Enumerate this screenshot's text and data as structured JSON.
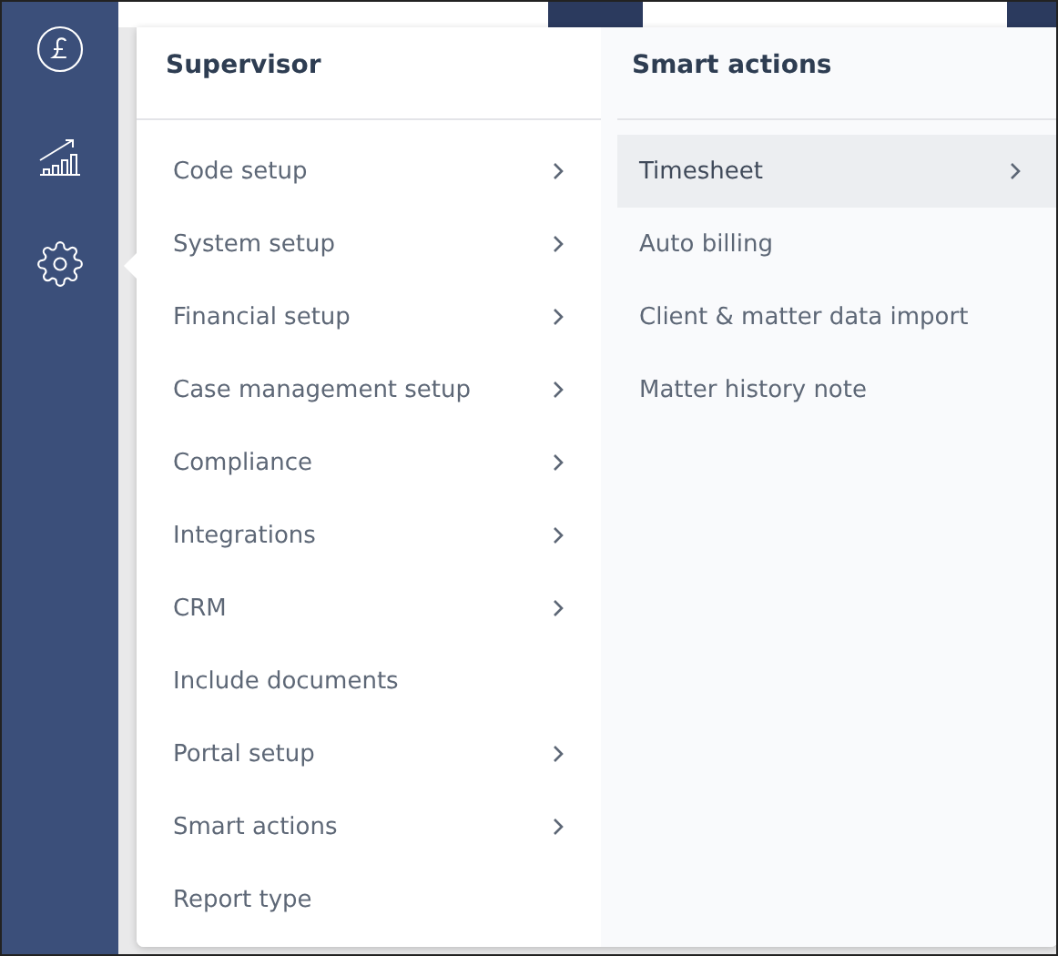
{
  "menu": {
    "title": "Supervisor",
    "items": [
      {
        "label": "Code setup",
        "has_submenu": true
      },
      {
        "label": "System setup",
        "has_submenu": true
      },
      {
        "label": "Financial setup",
        "has_submenu": true
      },
      {
        "label": "Case management setup",
        "has_submenu": true
      },
      {
        "label": "Compliance",
        "has_submenu": true
      },
      {
        "label": "Integrations",
        "has_submenu": true
      },
      {
        "label": "CRM",
        "has_submenu": true
      },
      {
        "label": "Include documents",
        "has_submenu": false
      },
      {
        "label": "Portal setup",
        "has_submenu": true
      },
      {
        "label": "Smart actions",
        "has_submenu": true
      },
      {
        "label": "Report type",
        "has_submenu": false
      }
    ]
  },
  "submenu": {
    "title": "Smart actions",
    "items": [
      {
        "label": "Timesheet",
        "has_submenu": true,
        "selected": true
      },
      {
        "label": "Auto billing",
        "has_submenu": false,
        "selected": false
      },
      {
        "label": "Client & matter data import",
        "has_submenu": false,
        "selected": false
      },
      {
        "label": "Matter history note",
        "has_submenu": false,
        "selected": false
      }
    ]
  }
}
